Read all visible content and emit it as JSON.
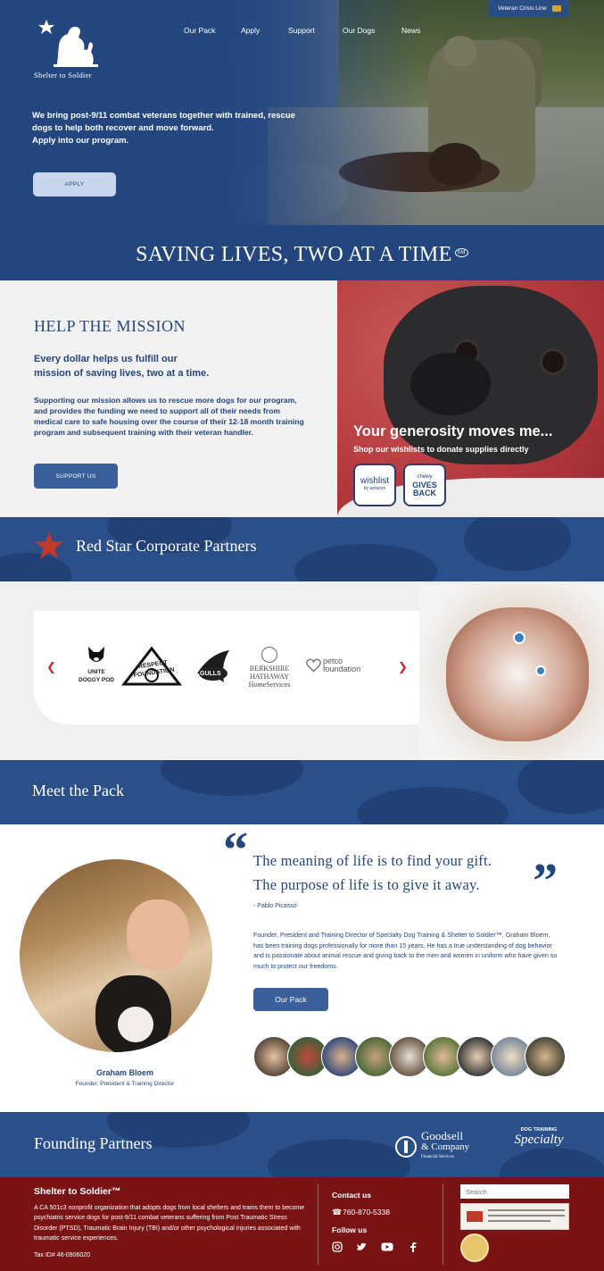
{
  "brand": {
    "name": "Shelter to Soldier"
  },
  "nav": {
    "items": [
      "Our Pack",
      "Apply",
      "Support",
      "Our Dogs",
      "News"
    ]
  },
  "crisis_line": {
    "label": "Veteran Crisis Line"
  },
  "hero": {
    "copy_line1": "We bring post-9/11 combat veterans  together with trained, rescue",
    "copy_line2": "dogs to help both recover and move forward.",
    "copy_line3": "Apply into our program.",
    "apply_label": "APPLY"
  },
  "tagline": {
    "text": "SAVING LIVES, TWO AT A TIME",
    "mark": "SM"
  },
  "mission": {
    "title": "HELP THE MISSION",
    "lead_line1": "Every dollar helps us fulfill our",
    "lead_line2": "mission of saving lives, two at a time.",
    "body": "Supporting our mission allows us to rescue more dogs for our program, and provides the funding we need to support all of their needs from medical care to safe housing over the course of their 12-18 month training program and subsequent training with their veteran handler.",
    "button": "SUPPORT US"
  },
  "generosity": {
    "title": "Your generosity moves me...",
    "subtitle": "Shop our wishlists to donate supplies directly",
    "wishlist_badge": {
      "line1": "wishlist",
      "line2": "by amazon"
    },
    "chewy_badge": {
      "line1": "chewy",
      "line2": "GIVES",
      "line3": "BACK"
    }
  },
  "red_star": {
    "title": "Red Star Corporate Partners"
  },
  "partners": {
    "logos": [
      {
        "name": "UNITE DOGGY POD",
        "icon": "boston-terrier-icon"
      },
      {
        "name": "RESPECT FOUNDATION",
        "icon": "respect-logo"
      },
      {
        "name": "GULLS",
        "icon": "gulls-logo"
      },
      {
        "name": "BERKSHIRE HATHAWAY HomeServices",
        "icon": "bhhs-logo"
      },
      {
        "name": "petco foundation",
        "icon": "petco-heart-icon"
      }
    ],
    "prev_icon": "chevron-left-icon",
    "next_icon": "chevron-right-icon"
  },
  "pack": {
    "title": "Meet the Pack",
    "quote_line1": "The meaning of life is to find your gift.",
    "quote_line2": "The purpose of life is to give it away.",
    "author": "- Pablo Picasso",
    "bio": "Founder, President and Training Director of Specialty Dog Training & Shelter to Soldier™, Graham Bloem, has been training dogs professionally for more than 15 years. He has a true understanding of dog behavior and is passionate about animal rescue and giving back to the men and women in uniform who have given so much to protect our freedoms.",
    "button": "Our Pack",
    "person_name": "Graham Bloem",
    "person_role": "Founder, President & Training Director"
  },
  "founding": {
    "title": "Founding Partners",
    "goodsell": {
      "line1": "Goodsell",
      "line2": "& Company",
      "line3": "Financial Services"
    },
    "specialty": {
      "line1": "DOG TRAINING",
      "line2": "Specialty"
    }
  },
  "footer": {
    "title": "Shelter to Soldier™",
    "body": "A CA 501c3 nonprofit organization that adopts dogs from local shelters and trains them to become psychiatric service dogs for post-9/11 combat veterans suffering from Post Traumatic Stress Disorder (PTSD), Traumatic Brain Injury (TBI) and/or other psychological injuries associated with traumatic service experiences.",
    "tax": "Tax ID# 46-0906020",
    "contact_title": "Contact us",
    "phone": "760-870-5338",
    "follow_title": "Follow us",
    "search_placeholder": "Search",
    "social_icons": [
      "instagram-icon",
      "twitter-icon",
      "youtube-icon",
      "facebook-icon"
    ]
  },
  "colors": {
    "navy": "#23467e",
    "button_blue": "#3a5f9b",
    "footer_red": "#7a1414",
    "accent_red": "#c02a2a"
  }
}
